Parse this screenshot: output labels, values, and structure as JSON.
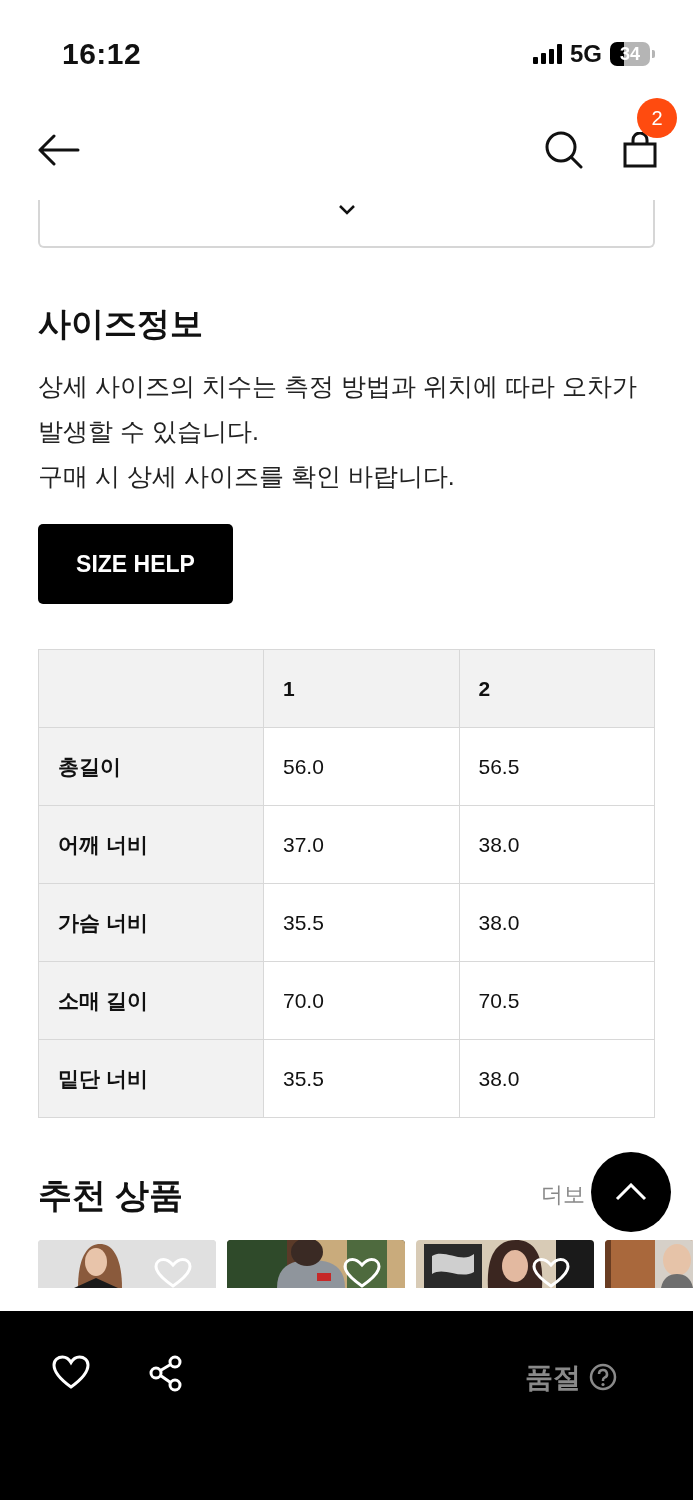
{
  "status_bar": {
    "time": "16:12",
    "network": "5G",
    "battery": "34"
  },
  "nav": {
    "cart_count": "2"
  },
  "size_info": {
    "title": "사이즈정보",
    "description": [
      "상세 사이즈의 치수는 측정 방법과 위치에 따라 오차가",
      "발생할 수 있습니다.",
      "구매 시 상세 사이즈를 확인 바랍니다."
    ],
    "help_button": "SIZE HELP",
    "table": {
      "columns": [
        "1",
        "2"
      ],
      "rows": [
        {
          "label": "총길이",
          "values": [
            "56.0",
            "56.5"
          ]
        },
        {
          "label": "어깨 너비",
          "values": [
            "37.0",
            "38.0"
          ]
        },
        {
          "label": "가슴 너비",
          "values": [
            "35.5",
            "38.0"
          ]
        },
        {
          "label": "소매 길이",
          "values": [
            "70.0",
            "70.5"
          ]
        },
        {
          "label": "밑단 너비",
          "values": [
            "35.5",
            "38.0"
          ]
        }
      ]
    }
  },
  "recommended": {
    "title": "추천 상품",
    "more": "더보"
  },
  "bottom_bar": {
    "wishlisted": false,
    "status": "품절"
  }
}
